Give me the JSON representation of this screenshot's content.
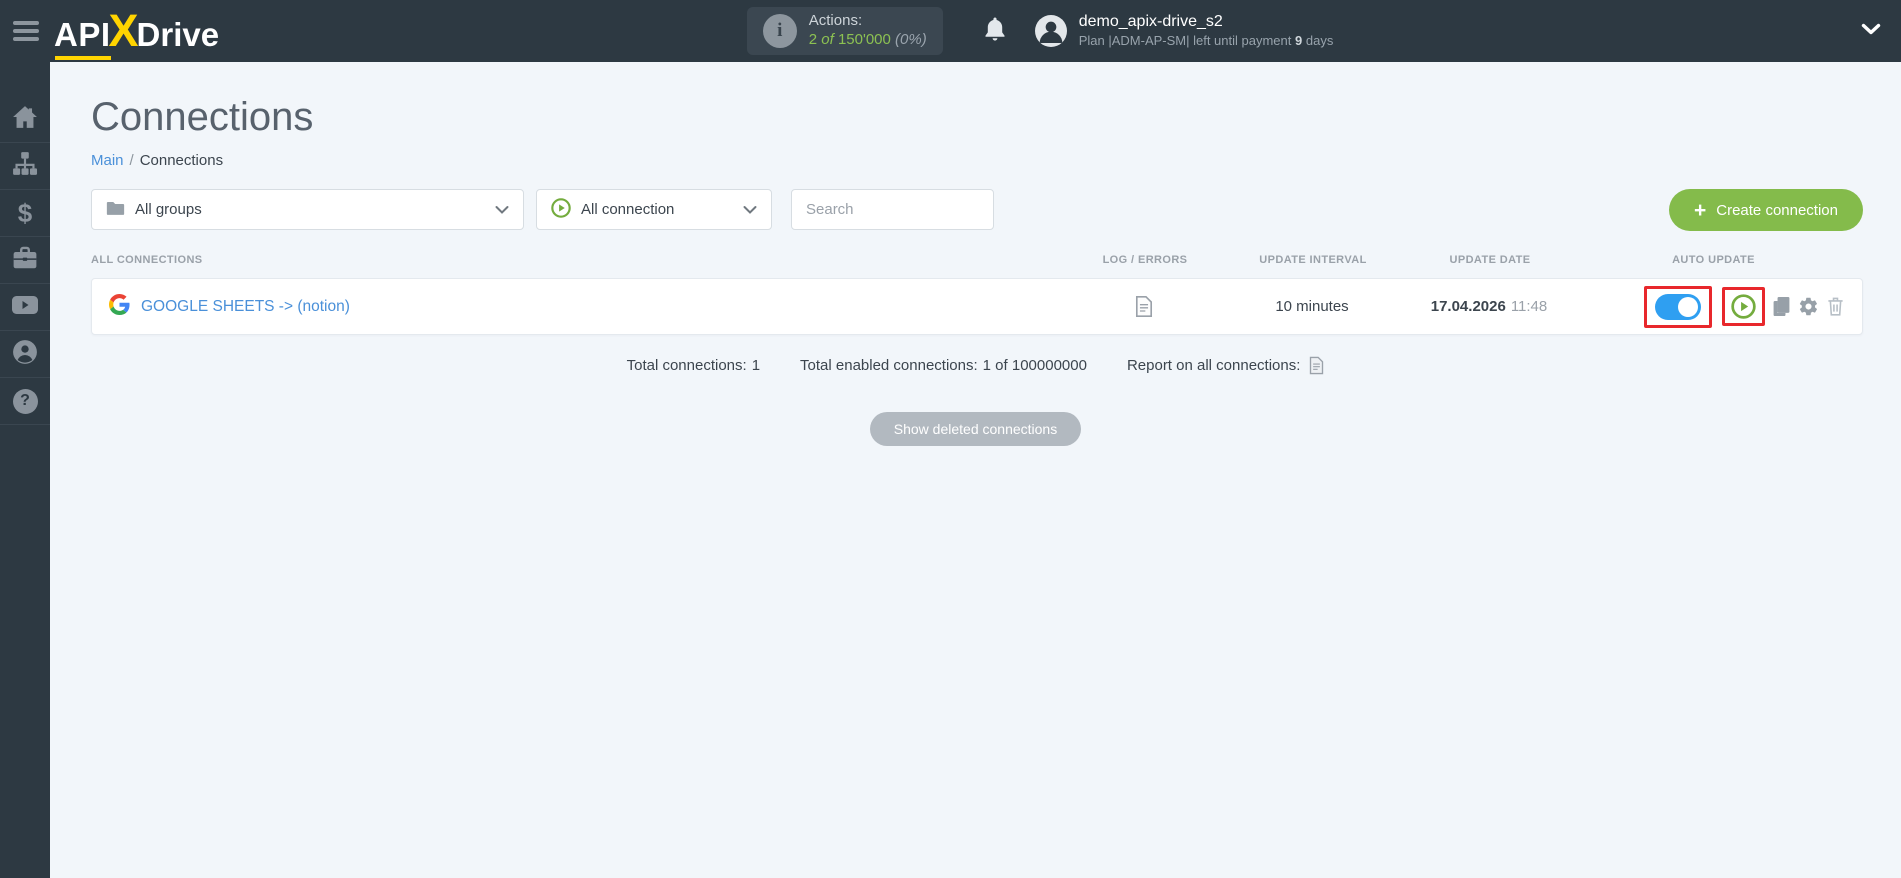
{
  "header": {
    "logo": {
      "api": "API",
      "x": "X",
      "drive": "Drive"
    },
    "actions": {
      "label": "Actions:",
      "used": "2",
      "of_word": "of",
      "total": "150'000",
      "percent": "(0%)",
      "info_glyph": "i"
    },
    "user": {
      "name": "demo_apix-drive_s2",
      "plan": "Plan |ADM-AP-SM| left until payment",
      "days_value": "9",
      "days_word": "days"
    }
  },
  "sidebar": {
    "items": [
      {
        "id": "home",
        "icon": "home-icon"
      },
      {
        "id": "connections",
        "icon": "sitemap-icon"
      },
      {
        "id": "payments",
        "icon": "dollar-icon",
        "glyph": "$"
      },
      {
        "id": "services",
        "icon": "briefcase-icon"
      },
      {
        "id": "video-guides",
        "icon": "youtube-icon"
      },
      {
        "id": "profile",
        "icon": "user-icon"
      },
      {
        "id": "help",
        "icon": "question-icon",
        "glyph": "?"
      }
    ]
  },
  "page": {
    "title": "Connections",
    "breadcrumb": {
      "main": "Main",
      "separator": "/",
      "current": "Connections"
    },
    "filters": {
      "groups_label": "All groups",
      "connection_label": "All connection",
      "search_placeholder": "Search"
    },
    "create_button": {
      "plus": "+",
      "label": "Create connection"
    },
    "table": {
      "headers": [
        "ALL CONNECTIONS",
        "LOG / ERRORS",
        "UPDATE INTERVAL",
        "UPDATE DATE",
        "AUTO UPDATE"
      ],
      "row": {
        "name": "GOOGLE SHEETS -> (notion)",
        "interval": "10 minutes",
        "date": "17.04.2026",
        "time": "11:48",
        "auto_update_enabled": true
      }
    },
    "totals": {
      "connections_label": "Total connections:",
      "connections_value": "1",
      "enabled_label": "Total enabled connections:",
      "enabled_value": "1 of 100000000",
      "report_label": "Report on all connections:"
    },
    "show_deleted_label": "Show deleted connections"
  },
  "colors": {
    "header_bg": "#2d3942",
    "accent_green": "#84bb4b",
    "link_blue": "#4a90d9",
    "toggle_blue": "#2f9ff1",
    "highlight_red": "#e8282c",
    "logo_yellow": "#ffd400",
    "page_bg": "#f2f6fa"
  }
}
